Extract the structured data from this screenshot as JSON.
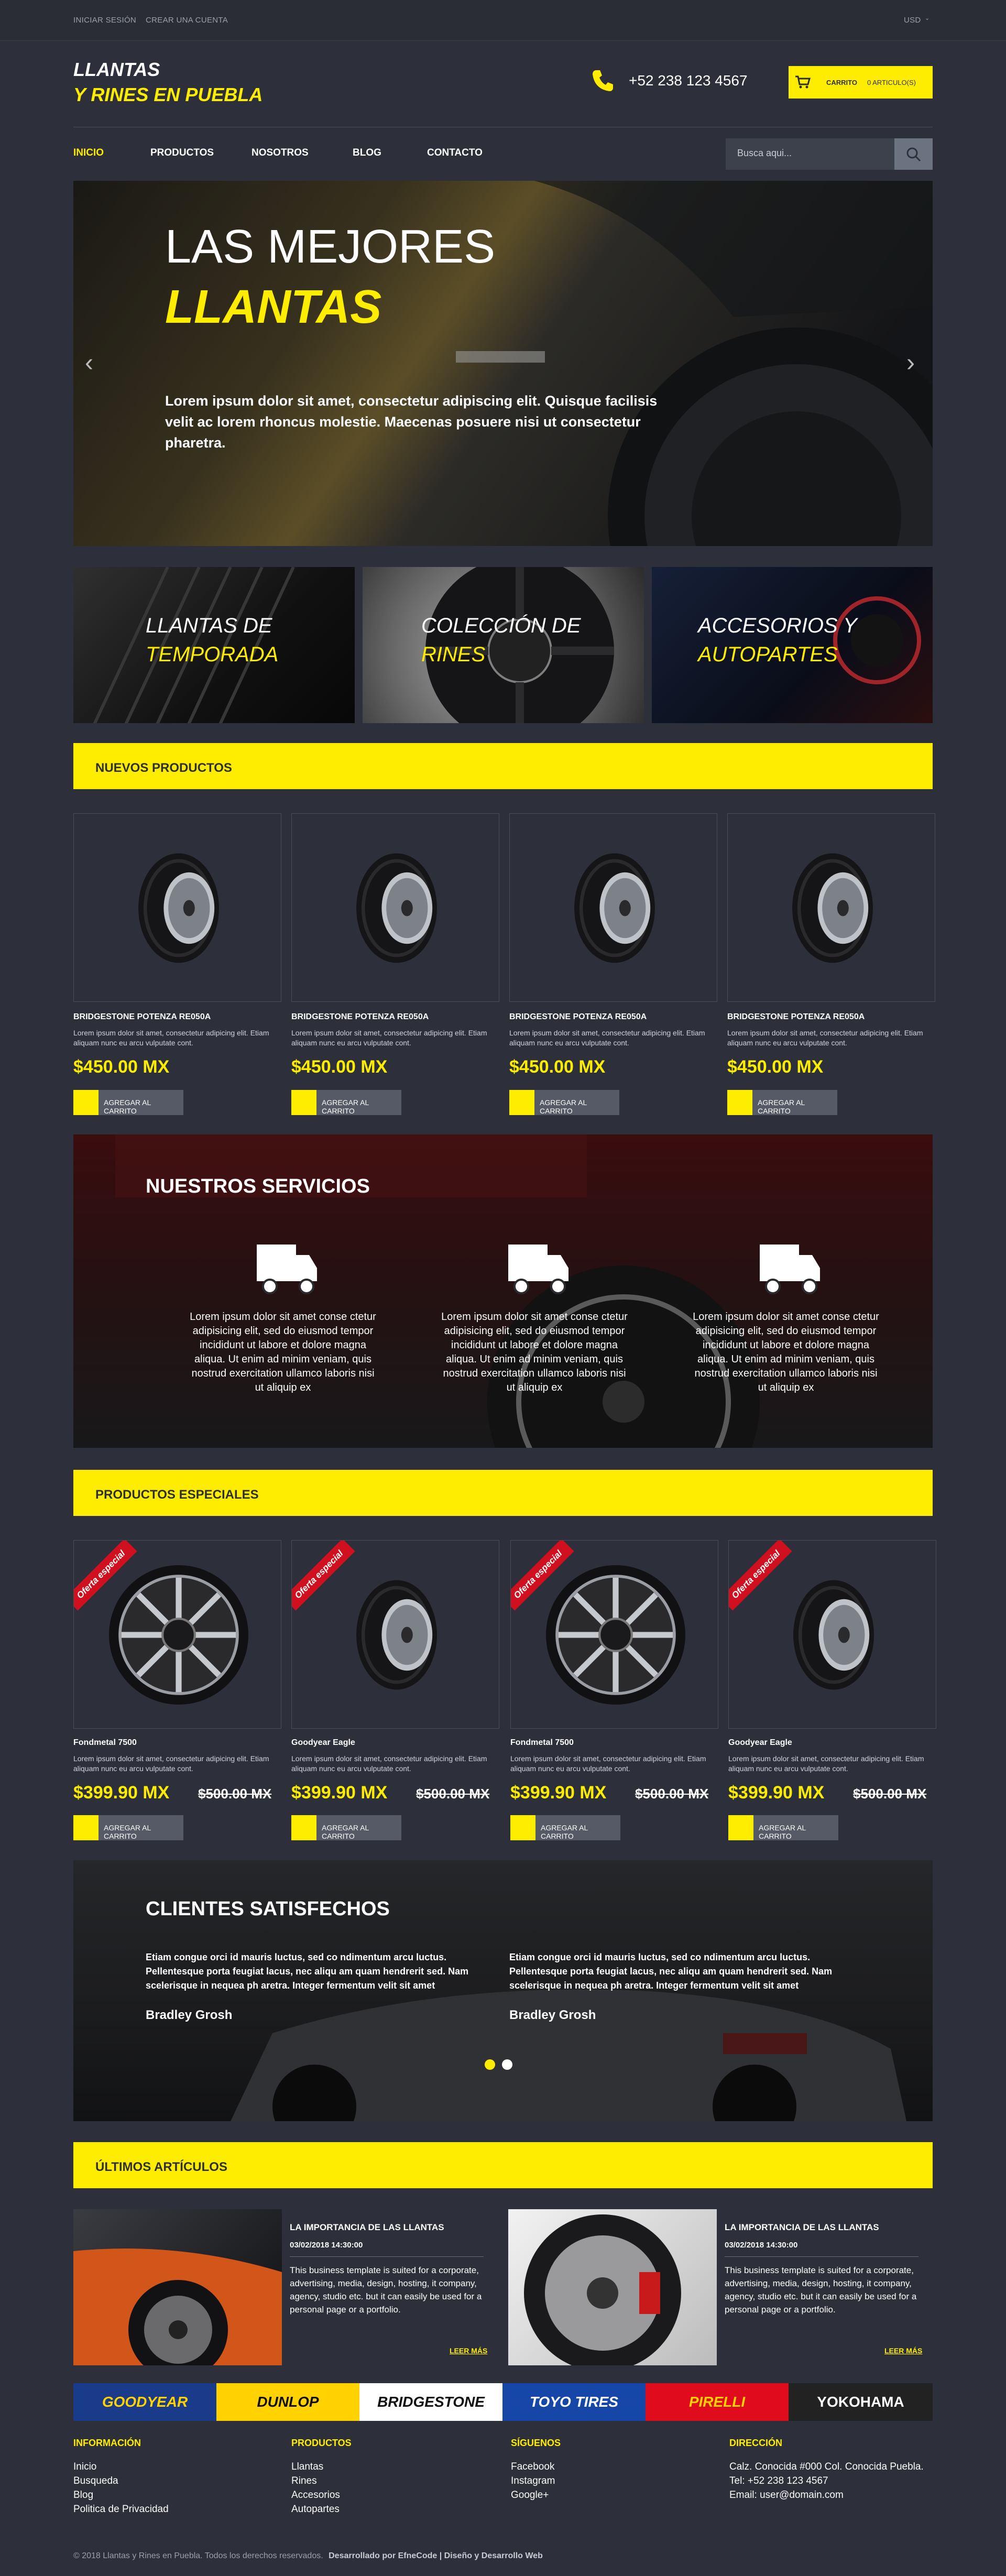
{
  "topbar": {
    "login": "INICIAR SESIÓN",
    "register": "CREAR UNA CUENTA",
    "currency": "USD"
  },
  "header": {
    "logo_line1": "LLANTAS",
    "logo_line2": "Y RINES EN PUEBLA",
    "phone": "+52 238 123 4567",
    "cart_label": "CARRITO",
    "cart_count": "0 ARTICULO(S)"
  },
  "nav": {
    "items": [
      "INICIO",
      "PRODUCTOS",
      "NOSOTROS",
      "BLOG",
      "CONTACTO"
    ],
    "search_placeholder": "Busca aqui..."
  },
  "hero": {
    "title1": "LAS MEJORES",
    "title2": "LLANTAS",
    "text": "Lorem ipsum dolor sit amet, consectetur adipiscing elit. Quisque facilisis velit ac lorem rhoncus molestie. Maecenas posuere nisi ut consectetur pharetra."
  },
  "categories": [
    {
      "line1": "LLANTAS DE",
      "line2": "TEMPORADA"
    },
    {
      "line1": "COLECCIÓN DE",
      "line2": "RINES"
    },
    {
      "line1": "ACCESORIOS Y",
      "line2": "AUTOPARTES"
    }
  ],
  "new_products": {
    "heading": "NUEVOS PRODUCTOS",
    "items": [
      {
        "name": "BRIDGESTONE POTENZA RE050A",
        "desc": "Lorem ipsum dolor sit amet, consectetur adipicing elit. Etiam aliquam nunc eu arcu vulputate cont.",
        "price": "$450.00 MX",
        "btn": "AGREGAR AL CARRITO"
      },
      {
        "name": "BRIDGESTONE POTENZA RE050A",
        "desc": "Lorem ipsum dolor sit amet, consectetur adipicing elit. Etiam aliquam nunc eu arcu vulputate cont.",
        "price": "$450.00 MX",
        "btn": "AGREGAR AL CARRITO"
      },
      {
        "name": "BRIDGESTONE POTENZA RE050A",
        "desc": "Lorem ipsum dolor sit amet, consectetur adipicing elit. Etiam aliquam nunc eu arcu vulputate cont.",
        "price": "$450.00 MX",
        "btn": "AGREGAR AL CARRITO"
      },
      {
        "name": "BRIDGESTONE POTENZA RE050A",
        "desc": "Lorem ipsum dolor sit amet, consectetur adipicing elit. Etiam aliquam nunc eu arcu vulputate cont.",
        "price": "$450.00 MX",
        "btn": "AGREGAR AL CARRITO"
      }
    ]
  },
  "services": {
    "heading": "NUESTROS SERVICIOS",
    "text": "Lorem ipsum dolor sit amet conse ctetur adipisicing elit, sed do eiusmod tempor incididunt ut labore et dolore magna aliqua. Ut enim ad minim veniam, quis nostrud exercitation ullamco laboris nisi ut aliquip ex"
  },
  "special_products": {
    "heading": "PRODUCTOS ESPECIALES",
    "ribbon": "Oferta especial",
    "items": [
      {
        "name": "Fondmetal 7500",
        "desc": "Lorem ipsum dolor sit amet, consectetur adipicing elit. Etiam aliquam nunc eu arcu vulputate cont.",
        "price": "$399.90 MX",
        "old": "$500.00 MX",
        "btn": "AGREGAR AL CARRITO"
      },
      {
        "name": "Goodyear Eagle",
        "desc": "Lorem ipsum dolor sit amet, consectetur adipicing elit. Etiam aliquam nunc eu arcu vulputate cont.",
        "price": "$399.90 MX",
        "old": "$500.00 MX",
        "btn": "AGREGAR AL CARRITO"
      },
      {
        "name": "Fondmetal 7500",
        "desc": "Lorem ipsum dolor sit amet, consectetur adipicing elit. Etiam aliquam nunc eu arcu vulputate cont.",
        "price": "$399.90 MX",
        "old": "$500.00 MX",
        "btn": "AGREGAR AL CARRITO"
      },
      {
        "name": "Goodyear Eagle",
        "desc": "Lorem ipsum dolor sit amet, consectetur adipicing elit. Etiam aliquam nunc eu arcu vulputate cont.",
        "price": "$399.90 MX",
        "old": "$500.00 MX",
        "btn": "AGREGAR AL CARRITO"
      }
    ]
  },
  "testimonials": {
    "heading": "CLIENTES SATISFECHOS",
    "items": [
      {
        "text": "Etiam congue orci id mauris luctus, sed co ndimentum arcu luctus. Pellentesque porta feugiat lacus, nec aliqu am quam hendrerit sed. Nam scelerisque in nequea ph aretra. Integer fermentum velit sit amet",
        "author": "Bradley Grosh"
      },
      {
        "text": "Etiam congue orci id mauris luctus, sed co ndimentum arcu luctus. Pellentesque porta feugiat lacus, nec aliqu am quam hendrerit sed. Nam scelerisque in nequea ph aretra. Integer fermentum velit sit amet",
        "author": "Bradley Grosh"
      }
    ]
  },
  "articles": {
    "heading": "ÚLTIMOS ARTÍCULOS",
    "items": [
      {
        "title": "LA IMPORTANCIA DE LAS LLANTAS",
        "date": "03/02/2018 14:30:00",
        "body": "This business template is suited for a corporate, advertising, media, design, hosting, it company, agency, studio etc. but it can easily be used for a personal page or a portfolio.",
        "more": "LEER MÁS"
      },
      {
        "title": "LA IMPORTANCIA DE LAS LLANTAS",
        "date": "03/02/2018 14:30:00",
        "body": "This business template is suited for a corporate, advertising, media, design, hosting, it company, agency, studio etc. but it can easily be used for a personal page or a portfolio.",
        "more": "LEER MÁS"
      }
    ]
  },
  "brands": [
    "GOODYEAR",
    "DUNLOP",
    "BRIDGESTONE",
    "TOYO TIRES",
    "PIRELLI",
    "YOKOHAMA"
  ],
  "footer": {
    "info": {
      "heading": "INFORMACIÓN",
      "links": [
        "Inicio",
        "Busqueda",
        "Blog",
        "Politica de Privacidad"
      ]
    },
    "products": {
      "heading": "PRODUCTOS",
      "links": [
        "Llantas",
        "Rines",
        "Accesorios",
        "Autopartes"
      ]
    },
    "follow": {
      "heading": "SÍGUENOS",
      "links": [
        "Facebook",
        "Instagram",
        "Google+"
      ]
    },
    "address": {
      "heading": "DIRECCIÓN",
      "lines": [
        "Calz. Conocida #000 Col. Conocida Puebla.",
        "Tel: +52 238 123 4567",
        "Email: user@domain.com"
      ]
    },
    "copyright": "© 2018 Llantas y Rines en Puebla. Todos los derechos reservados.",
    "credit": "Desarrollado por EfneCode | Diseño y Desarrollo Web"
  }
}
